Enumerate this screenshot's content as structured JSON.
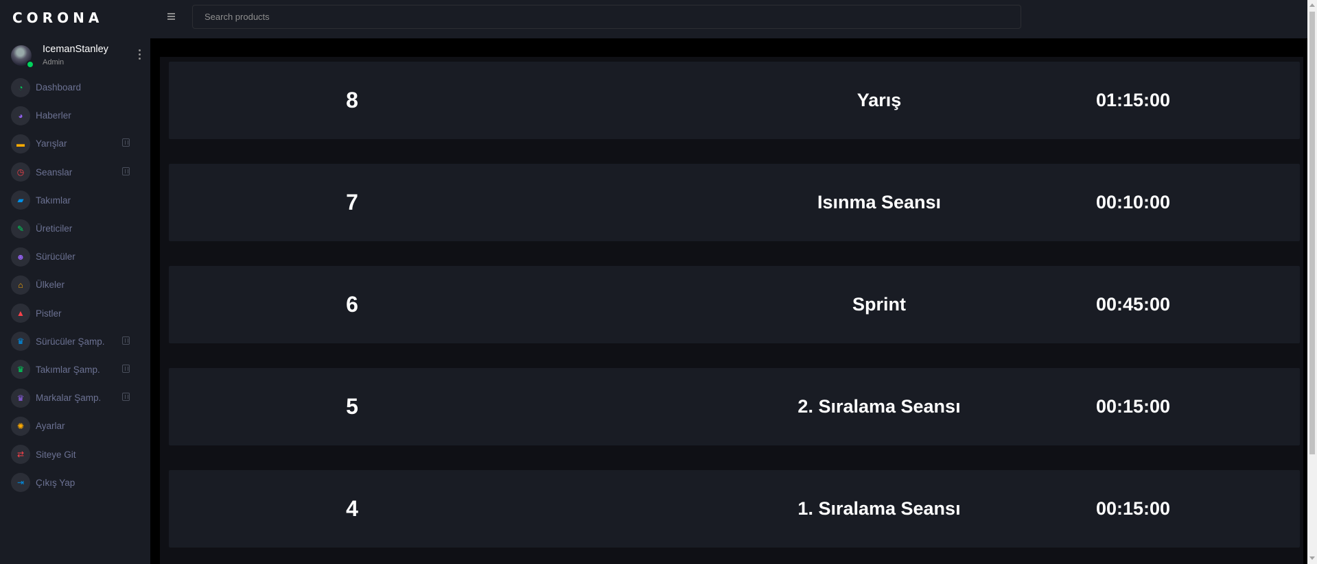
{
  "brand": "CORONA",
  "profile": {
    "name": "IcemanStanley",
    "role": "Admin"
  },
  "search": {
    "placeholder": "Search products"
  },
  "sidebar": {
    "items": [
      {
        "label": "Dashboard",
        "icon": "speedometer-icon",
        "icon_color": "#00d25b",
        "glyph": "◔",
        "expandable": false
      },
      {
        "label": "Haberler",
        "icon": "gauge-icon",
        "icon_color": "#8f5fe8",
        "glyph": "◕",
        "expandable": false
      },
      {
        "label": "Yarışlar",
        "icon": "car-icon",
        "icon_color": "#ffab00",
        "glyph": "▬",
        "expandable": true
      },
      {
        "label": "Seanslar",
        "icon": "timer-icon",
        "icon_color": "#fc424a",
        "glyph": "◷",
        "expandable": true
      },
      {
        "label": "Takımlar",
        "icon": "truck-icon",
        "icon_color": "#0090e7",
        "glyph": "▰",
        "expandable": false
      },
      {
        "label": "Üreticiler",
        "icon": "wrench-icon",
        "icon_color": "#00d25b",
        "glyph": "✎",
        "expandable": false
      },
      {
        "label": "Sürücüler",
        "icon": "people-icon",
        "icon_color": "#8f5fe8",
        "glyph": "☻",
        "expandable": false
      },
      {
        "label": "Ülkeler",
        "icon": "home-icon",
        "icon_color": "#ffab00",
        "glyph": "⌂",
        "expandable": false
      },
      {
        "label": "Pistler",
        "icon": "road-icon",
        "icon_color": "#fc424a",
        "glyph": "▲",
        "expandable": false
      },
      {
        "label": "Sürücüler Şamp.",
        "icon": "trophy-icon",
        "icon_color": "#0090e7",
        "glyph": "♛",
        "expandable": true
      },
      {
        "label": "Takımlar Şamp.",
        "icon": "trophy-icon",
        "icon_color": "#00d25b",
        "glyph": "♛",
        "expandable": true
      },
      {
        "label": "Markalar Şamp.",
        "icon": "trophy-icon",
        "icon_color": "#8f5fe8",
        "glyph": "♛",
        "expandable": true
      },
      {
        "label": "Ayarlar",
        "icon": "gear-icon",
        "icon_color": "#ffab00",
        "glyph": "✺",
        "expandable": false
      },
      {
        "label": "Siteye Git",
        "icon": "swap-icon",
        "icon_color": "#fc424a",
        "glyph": "⇄",
        "expandable": false
      },
      {
        "label": "Çıkış Yap",
        "icon": "logout-icon",
        "icon_color": "#0090e7",
        "glyph": "⇥",
        "expandable": false
      }
    ]
  },
  "sessions": [
    {
      "number": "8",
      "name": "Yarış",
      "duration": "01:15:00"
    },
    {
      "number": "7",
      "name": "Isınma Seansı",
      "duration": "00:10:00"
    },
    {
      "number": "6",
      "name": "Sprint",
      "duration": "00:45:00"
    },
    {
      "number": "5",
      "name": "2. Sıralama Seansı",
      "duration": "00:15:00"
    },
    {
      "number": "4",
      "name": "1. Sıralama Seansı",
      "duration": "00:15:00"
    }
  ]
}
